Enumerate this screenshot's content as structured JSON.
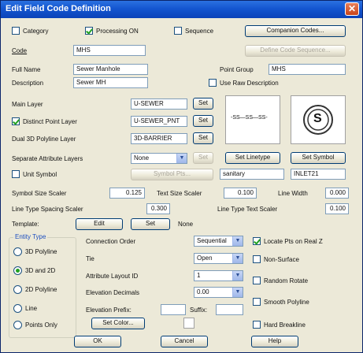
{
  "window": {
    "title": "Edit Field Code Definition",
    "close_glyph": "✕"
  },
  "top": {
    "category": "Category",
    "processing_on": "Processing ON",
    "sequence": "Sequence",
    "companion_codes": "Companion Codes...",
    "define_code_sequence": "Define Code Sequence..."
  },
  "fields": {
    "code_label": "Code",
    "code_value": "MHS",
    "full_name_label": "Full Name",
    "full_name_value": "Sewer Manhole",
    "description_label": "Description",
    "description_value": "Sewer MH",
    "point_group_label": "Point Group",
    "point_group_value": "MHS",
    "use_raw_description": "Use Raw Description"
  },
  "layers": {
    "main_layer_label": "Main Layer",
    "main_layer_value": "U-SEWER",
    "distinct_point_layer_label": "Distinct Point Layer",
    "distinct_point_layer_value": "U-SEWER_PNT",
    "dual_3d_label": "Dual 3D Polyline Layer",
    "dual_3d_value": "3D-BARRIER",
    "separate_attr_label": "Separate Attribute Layers",
    "separate_attr_value": "None",
    "set_label": "Set",
    "set_linetype": "Set Linetype",
    "set_symbol": "Set Symbol",
    "linetype_preview": "-SS—SS—SS-",
    "symbol_letter": "S"
  },
  "symbol": {
    "unit_symbol": "Unit Symbol",
    "symbol_pts": "Symbol Pts...",
    "linetype_name": "sanitary",
    "symbol_name": "INLET21"
  },
  "scalers": {
    "symbol_size_label": "Symbol Size Scaler",
    "symbol_size_value": "0.125",
    "text_size_label": "Text Size Scaler",
    "text_size_value": "0.100",
    "line_width_label": "Line Width",
    "line_width_value": "0.000",
    "line_type_spacing_label": "Line Type Spacing Scaler",
    "line_type_spacing_value": "0.300",
    "line_type_text_label": "Line Type Text Scaler",
    "line_type_text_value": "0.100"
  },
  "template": {
    "label": "Template:",
    "edit": "Edit",
    "set": "Set",
    "value": "None"
  },
  "entity_type": {
    "title": "Entity Type",
    "options": [
      "3D Polyline",
      "3D and 2D",
      "2D Polyline",
      "Line",
      "Points Only"
    ],
    "selected": "3D and 2D"
  },
  "options": {
    "connection_order_label": "Connection Order",
    "connection_order_value": "Sequential",
    "tie_label": "Tie",
    "tie_value": "Open",
    "attr_layout_label": "Attribute Layout ID",
    "attr_layout_value": "1",
    "elev_decimals_label": "Elevation Decimals",
    "elev_decimals_value": "0.00",
    "elev_prefix_label": "Elevation Prefix:",
    "suffix_label": "Suffix:",
    "set_color": "Set Color..."
  },
  "checks": {
    "locate_pts": "Locate Pts on Real Z",
    "non_surface": "Non-Surface",
    "random_rotate": "Random Rotate",
    "smooth_polyline": "Smooth Polyline",
    "hard_breakline": "Hard Breakline"
  },
  "bottom": {
    "ok": "OK",
    "cancel": "Cancel",
    "help": "Help"
  }
}
